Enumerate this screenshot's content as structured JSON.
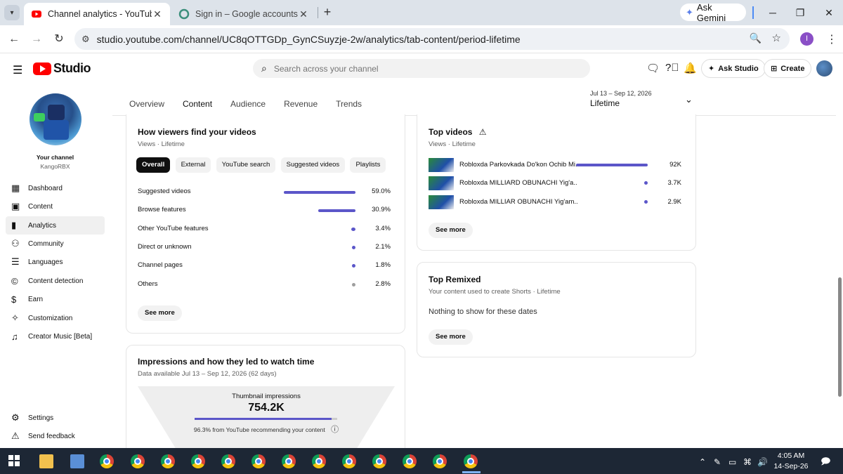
{
  "browser": {
    "tabs": [
      {
        "title": "Channel analytics - YouTube Studio",
        "active": true
      },
      {
        "title": "Sign in – Google accounts",
        "active": false
      }
    ],
    "new_tab": "+",
    "gemini_label": "Ask Gemini",
    "url": "studio.youtube.com/channel/UC8qOTTGDp_GynCSuyzje-2w/analytics/tab-content/period-lifetime",
    "profile_initial": "I"
  },
  "studio": {
    "brand": "Studio",
    "search_placeholder": "Search across your channel",
    "ask_studio": "Ask Studio",
    "create": "Create"
  },
  "tabs": [
    "Overview",
    "Content",
    "Audience",
    "Revenue",
    "Trends"
  ],
  "period": {
    "range": "Jul 13 – Sep 12, 2026",
    "label": "Lifetime"
  },
  "sidebar": {
    "your_channel": "Your channel",
    "channel_name": "KangoRBX",
    "items": [
      {
        "label": "Dashboard",
        "icon": "dashboard-icon"
      },
      {
        "label": "Content",
        "icon": "content-icon"
      },
      {
        "label": "Analytics",
        "icon": "analytics-icon"
      },
      {
        "label": "Community",
        "icon": "community-icon"
      },
      {
        "label": "Languages",
        "icon": "languages-icon"
      },
      {
        "label": "Content detection",
        "icon": "copyright-icon"
      },
      {
        "label": "Earn",
        "icon": "dollar-icon"
      },
      {
        "label": "Customization",
        "icon": "magic-wand-icon"
      },
      {
        "label": "Creator Music [Beta]",
        "icon": "music-icon"
      }
    ],
    "settings": "Settings",
    "feedback": "Send feedback"
  },
  "traffic": {
    "title": "How viewers find your videos",
    "subtitle": "Views · Lifetime",
    "chips": [
      "Overall",
      "External",
      "YouTube search",
      "Suggested videos",
      "Playlists"
    ],
    "rows": [
      {
        "label": "Suggested videos",
        "value": "59.0%",
        "pct": 59.0,
        "color": "#5b56c9"
      },
      {
        "label": "Browse features",
        "value": "30.9%",
        "pct": 30.9,
        "color": "#5b56c9"
      },
      {
        "label": "Other YouTube features",
        "value": "3.4%",
        "pct": 3.4,
        "color": "#5b56c9"
      },
      {
        "label": "Direct or unknown",
        "value": "2.1%",
        "pct": 2.1,
        "color": "#5b56c9"
      },
      {
        "label": "Channel pages",
        "value": "1.8%",
        "pct": 1.8,
        "color": "#5b56c9"
      },
      {
        "label": "Others",
        "value": "2.8%",
        "pct": 2.8,
        "color": "#9e9e9e"
      }
    ],
    "see_more": "See more"
  },
  "top_videos": {
    "title": "Top videos",
    "subtitle": "Views · Lifetime",
    "rows": [
      {
        "name": "Robloxda Parkovkada Do'kon Ochib Mi...",
        "value": "92K",
        "views": 92000
      },
      {
        "name": "Robloxda MILLIARD OBUNACHI Yig'a...",
        "value": "3.7K",
        "views": 3700
      },
      {
        "name": "Robloxda MILLIAR OBUNACHI Yig'am...",
        "value": "2.9K",
        "views": 2900
      }
    ],
    "see_more": "See more"
  },
  "top_remixed": {
    "title": "Top Remixed",
    "subtitle": "Your content used to create Shorts · Lifetime",
    "empty": "Nothing to show for these dates",
    "see_more": "See more"
  },
  "impressions": {
    "title": "Impressions and how they led to watch time",
    "subtitle": "Data available Jul 13 – Sep 12, 2026 (62 days)",
    "label": "Thumbnail impressions",
    "value": "754.2K",
    "note": "96.3% from YouTube recommending your content",
    "recommended_pct": 96.3
  },
  "taskbar": {
    "time": "4:05 AM",
    "date": "14-Sep-26"
  }
}
